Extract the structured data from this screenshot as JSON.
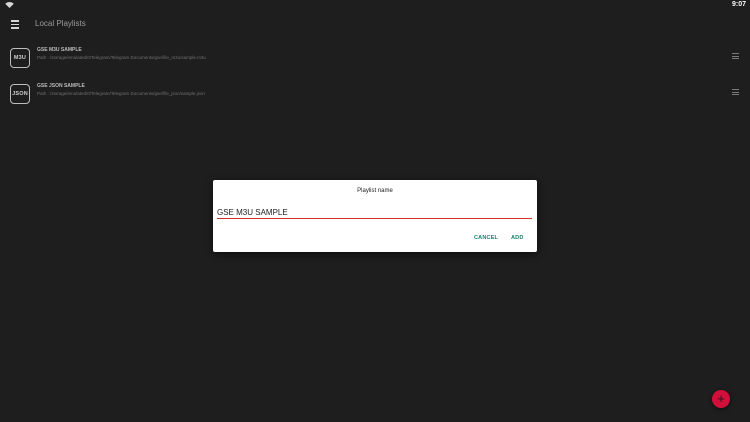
{
  "status_bar": {
    "time": "9:07",
    "wifi_icon": "wifi-icon"
  },
  "app_bar": {
    "title": "Local Playlists",
    "menu_icon": "hamburger-menu-icon"
  },
  "playlists": [
    {
      "badge": "M3U",
      "name": "GSE M3U SAMPLE",
      "path": "Path : /storage/emulated/0/Telegram/Telegram Documents/gse/file_m3u/sample.m3u",
      "drag_icon": "drag-handle-icon"
    },
    {
      "badge": "JSON",
      "name": "GSE JSON SAMPLE",
      "path": "Path : /storage/emulated/0/Telegram/Telegram Documents/gse/file_json/sample.json",
      "drag_icon": "drag-handle-icon"
    }
  ],
  "dialog": {
    "title": "Playlist name",
    "input_value": "GSE M3U SAMPLE",
    "cancel_label": "CANCEL",
    "add_label": "ADD"
  },
  "fab": {
    "icon": "plus-icon",
    "symbol": "+"
  },
  "colors": {
    "background": "#1e1e1f",
    "accent_red": "#d0103a",
    "button_teal": "#17806e",
    "input_underline": "#d32f2f"
  }
}
